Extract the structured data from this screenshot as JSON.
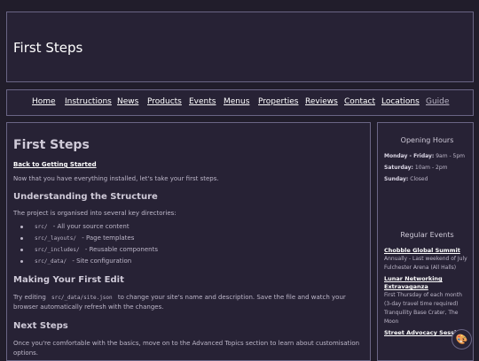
{
  "site": {
    "title": "First Steps"
  },
  "nav": {
    "items": [
      {
        "label": "Home"
      },
      {
        "label": "Instructions"
      },
      {
        "label": "News"
      },
      {
        "label": "Products"
      },
      {
        "label": "Events"
      },
      {
        "label": "Menus"
      },
      {
        "label": "Properties"
      },
      {
        "label": "Reviews"
      },
      {
        "label": "Contact"
      },
      {
        "label": "Locations"
      },
      {
        "label": "Guide"
      }
    ]
  },
  "main": {
    "title": "First Steps",
    "back_link": "Back to Getting Started",
    "intro": "Now that you have everything installed, let's take your first steps.",
    "section1": {
      "heading": "Understanding the Structure",
      "text": "The project is organised into several key directories:",
      "dirs": [
        {
          "code": "src/",
          "desc": "- All your source content"
        },
        {
          "code": "src/_layouts/",
          "desc": "- Page templates"
        },
        {
          "code": "src/_includes/",
          "desc": "- Reusable components"
        },
        {
          "code": "src/_data/",
          "desc": "- Site configuration"
        }
      ]
    },
    "section2": {
      "heading": "Making Your First Edit",
      "text_before": "Try editing",
      "code": "src/_data/site.json",
      "text_after": "to change your site's name and description. Save the file and watch your browser automatically refresh with the changes."
    },
    "section3": {
      "heading": "Next Steps",
      "text": "Once you're comfortable with the basics, move on to the Advanced Topics section to learn about customisation options."
    }
  },
  "sidebar": {
    "hours_title": "Opening Hours",
    "hours": [
      {
        "day": "Monday - Friday:",
        "time": "9am - 5pm"
      },
      {
        "day": "Saturday:",
        "time": "10am - 2pm"
      },
      {
        "day": "Sunday:",
        "time": "Closed"
      }
    ],
    "events_title": "Regular Events",
    "events": [
      {
        "title": "Chobble Global Summit",
        "when": "Annually - Last weekend of July",
        "where": "Fulchester Arena (All Halls)"
      },
      {
        "title": "Lunar Networking Extravaganza",
        "when": "First Thursday of each month (3-day travel time required)",
        "where": "Tranquility Base Crater, The Moon"
      },
      {
        "title": "Street Advocacy Sessions",
        "when": "",
        "where": ""
      }
    ]
  },
  "fab": {
    "icon": "palette-icon"
  }
}
